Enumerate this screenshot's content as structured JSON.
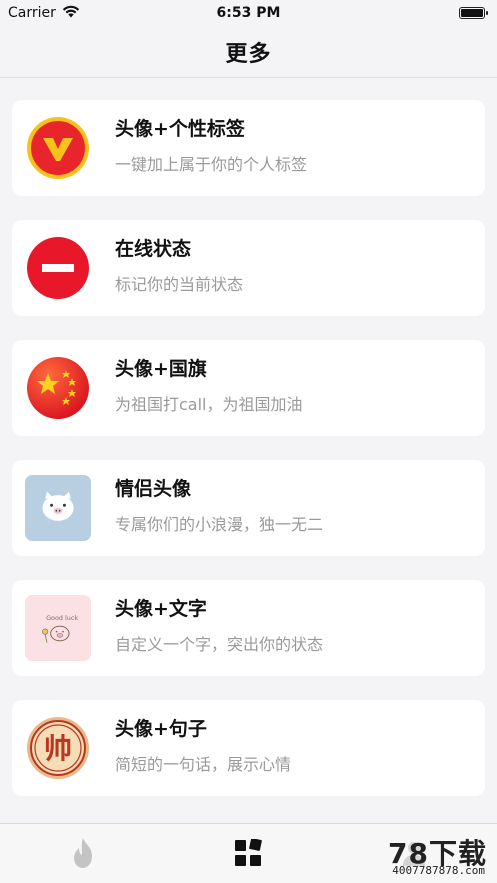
{
  "status_bar": {
    "carrier": "Carrier",
    "time": "6:53 PM"
  },
  "nav": {
    "title": "更多"
  },
  "items": [
    {
      "title": "头像+个性标签",
      "subtitle": "一键加上属于你的个人标签",
      "icon": "v-badge-icon"
    },
    {
      "title": "在线状态",
      "subtitle": "标记你的当前状态",
      "icon": "do-not-disturb-icon"
    },
    {
      "title": "头像+国旗",
      "subtitle": "为祖国打call，为祖国加油",
      "icon": "flag-stars-icon"
    },
    {
      "title": "情侣头像",
      "subtitle": "专属你们的小浪漫，独一无二",
      "icon": "pig-avatar-icon"
    },
    {
      "title": "头像+文字",
      "subtitle": "自定义一个字，突出你的状态",
      "icon": "good-luck-avatar-icon",
      "icon_text": "Good luck"
    },
    {
      "title": "头像+句子",
      "subtitle": "简短的一句话，展示心情",
      "icon": "shuai-seal-icon",
      "icon_text": "帅"
    }
  ],
  "tab_bar": {
    "tabs": [
      {
        "icon": "flame-icon",
        "active": false
      },
      {
        "icon": "grid-icon",
        "active": true
      },
      {
        "icon": "profile-icon",
        "active": false
      }
    ]
  },
  "watermark": {
    "main": "78下载",
    "url": "4007787878.com"
  },
  "colors": {
    "background": "#f4f4f6",
    "card": "#ffffff",
    "title": "#111111",
    "subtitle": "#9a9a9a",
    "red": "#e8232f",
    "gold": "#f5c518"
  }
}
